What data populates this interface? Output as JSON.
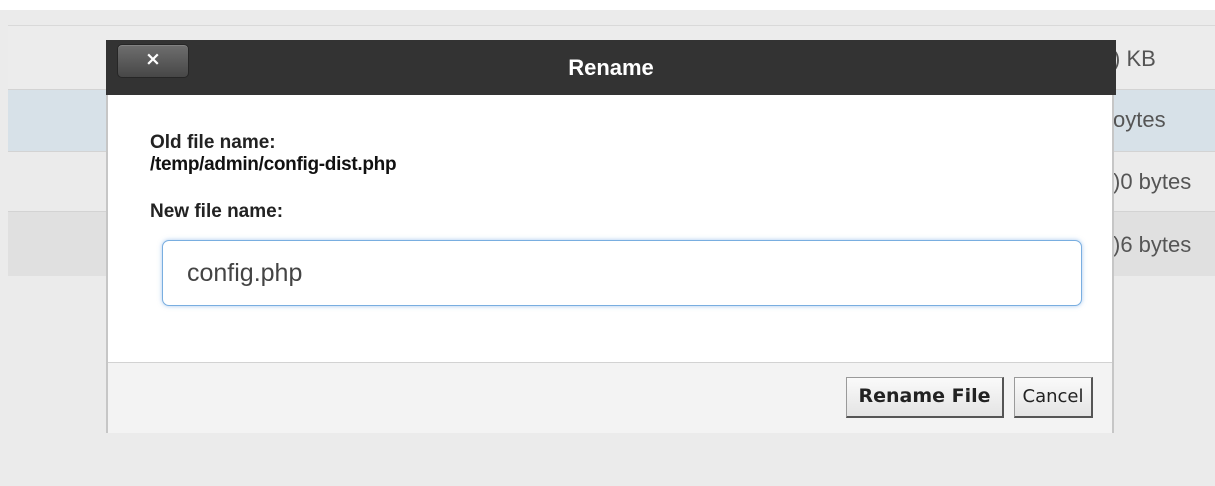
{
  "background_list": {
    "rows": [
      {
        "size": ") KB"
      },
      {
        "size": "oytes"
      },
      {
        "size": ")0 bytes"
      },
      {
        "size": ")6 bytes"
      }
    ]
  },
  "dialog": {
    "title": "Rename",
    "close_label": "×",
    "old_name_label": "Old file name:",
    "old_name_value": "/temp/admin/config-dist.php",
    "new_name_label": "New file name:",
    "new_name_value": "config.php",
    "rename_button_label": "Rename File",
    "cancel_button_label": "Cancel"
  },
  "colors": {
    "header_bg": "#333333",
    "input_focus_border": "#79aee0",
    "selected_row_bg": "#d7e1e8"
  }
}
